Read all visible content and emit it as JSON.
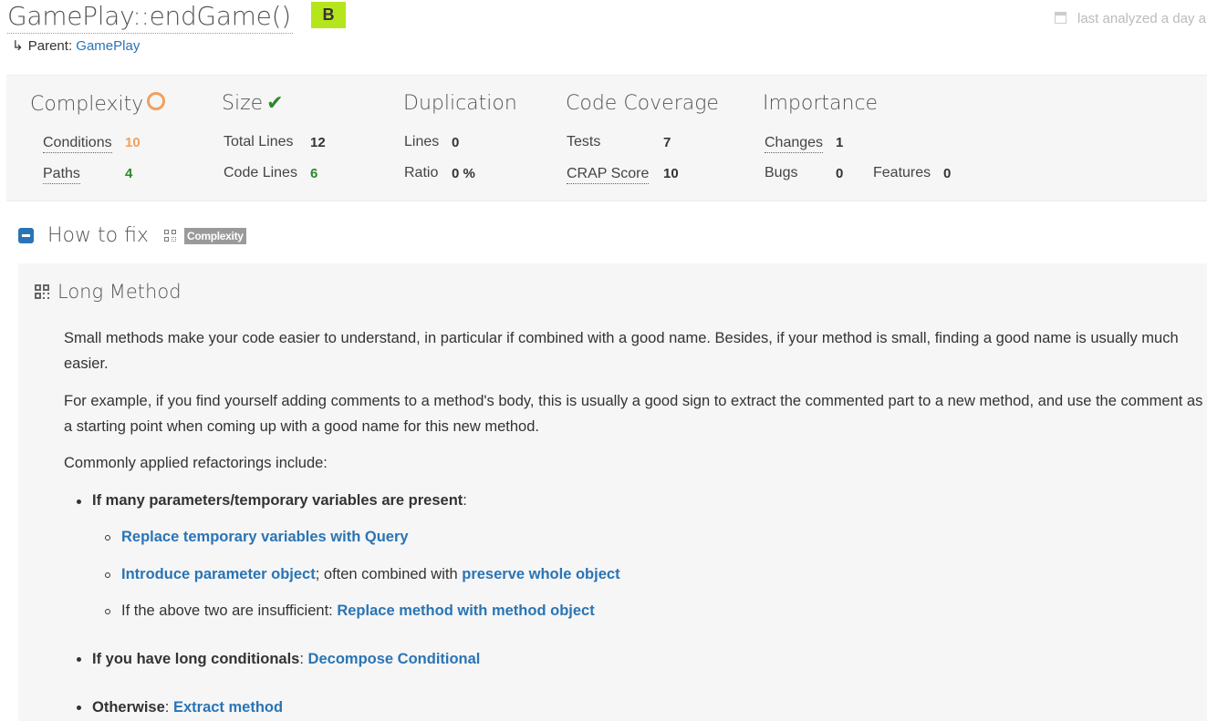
{
  "header": {
    "title": "GamePlay::endGame()",
    "grade": "B",
    "grade_color": "#b5e61d",
    "analyzed": "last analyzed a day a",
    "parent_label": "Parent:",
    "parent_link": "GamePlay"
  },
  "metrics": {
    "complexity": {
      "heading": "Complexity",
      "status_icon": "warning-ring-icon",
      "conditions_label": "Conditions",
      "conditions_value": "10",
      "paths_label": "Paths",
      "paths_value": "4"
    },
    "size": {
      "heading": "Size",
      "status_icon": "check-icon",
      "total_lines_label": "Total Lines",
      "total_lines_value": "12",
      "code_lines_label": "Code Lines",
      "code_lines_value": "6"
    },
    "duplication": {
      "heading": "Duplication",
      "lines_label": "Lines",
      "lines_value": "0",
      "ratio_label": "Ratio",
      "ratio_value": "0 %"
    },
    "coverage": {
      "heading": "Code Coverage",
      "tests_label": "Tests",
      "tests_value": "7",
      "crap_label": "CRAP Score",
      "crap_value": "10"
    },
    "importance": {
      "heading": "Importance",
      "changes_label": "Changes",
      "changes_value": "1",
      "bugs_label": "Bugs",
      "bugs_value": "0",
      "features_label": "Features",
      "features_value": "0"
    },
    "colors": {
      "orange": "#f0a060",
      "green": "#2a8a2a"
    }
  },
  "howto": {
    "title": "How to fix",
    "tag": "Complexity"
  },
  "long_method": {
    "title": "Long Method",
    "para1": "Small methods make your code easier to understand, in particular if combined with a good name. Besides, if your method is small, finding a good name is usually much easier.",
    "para2": "For example, if you find yourself adding comments to a method's body, this is usually a good sign to extract the commented part to a new method, and use the comment as a starting point when coming up with a good name for this new method.",
    "para3": "Commonly applied refactorings include:",
    "item1": "If many parameters/temporary variables are present",
    "item1_sub1_link": "Replace temporary variables with Query",
    "item1_sub2_link": "Introduce parameter object",
    "item1_sub2_text": "; often combined with ",
    "item1_sub2_link2": "preserve whole object",
    "item1_sub3_text": "If the above two are insufficient: ",
    "item1_sub3_link": "Replace method with method object",
    "item2": "If you have long conditionals",
    "item2_link": "Decompose Conditional",
    "item3": "Otherwise",
    "item3_link": "Extract method",
    "colon": ":"
  }
}
